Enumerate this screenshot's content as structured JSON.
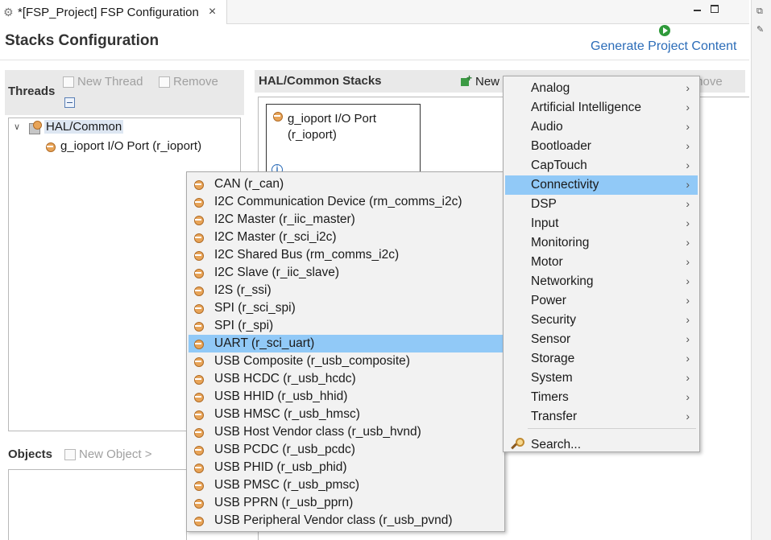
{
  "editor_tab": {
    "title": "*[FSP_Project] FSP Configuration",
    "close": "×"
  },
  "header": {
    "title": "Stacks Configuration",
    "generate_label": "Generate Project Content"
  },
  "threads": {
    "title": "Threads",
    "new_thread": "New Thread",
    "remove": "Remove",
    "tree": {
      "root": "HAL/Common",
      "child": "g_ioport I/O Port (r_ioport)"
    }
  },
  "objects": {
    "title": "Objects",
    "new_object": "New Object >"
  },
  "hal_stacks": {
    "title": "HAL/Common Stacks",
    "new": "New",
    "remove": "move",
    "block_line1": "g_ioport I/O Port",
    "block_line2": "(r_ioport)"
  },
  "category_menu": {
    "items": [
      "Analog",
      "Artificial Intelligence",
      "Audio",
      "Bootloader",
      "CapTouch",
      "Connectivity",
      "DSP",
      "Input",
      "Monitoring",
      "Motor",
      "Networking",
      "Power",
      "Security",
      "Sensor",
      "Storage",
      "System",
      "Timers",
      "Transfer"
    ],
    "selected": "Connectivity",
    "search": "Search..."
  },
  "connectivity_menu": {
    "items": [
      "CAN (r_can)",
      "I2C Communication Device (rm_comms_i2c)",
      "I2C Master (r_iic_master)",
      "I2C Master (r_sci_i2c)",
      "I2C Shared Bus (rm_comms_i2c)",
      "I2C Slave (r_iic_slave)",
      "I2S (r_ssi)",
      "SPI (r_sci_spi)",
      "SPI (r_spi)",
      "UART (r_sci_uart)",
      "USB Composite (r_usb_composite)",
      "USB HCDC (r_usb_hcdc)",
      "USB HHID (r_usb_hhid)",
      "USB HMSC (r_usb_hmsc)",
      "USB Host Vendor class (r_usb_hvnd)",
      "USB PCDC (r_usb_pcdc)",
      "USB PHID (r_usb_phid)",
      "USB PMSC (r_usb_pmsc)",
      "USB PPRN (r_usb_pprn)",
      "USB Peripheral Vendor class (r_usb_pvnd)"
    ],
    "selected": "UART (r_sci_uart)"
  },
  "colors": {
    "selection": "#91c9f7",
    "link": "#2b6cb8",
    "menu_bg": "#f2f2f2"
  }
}
